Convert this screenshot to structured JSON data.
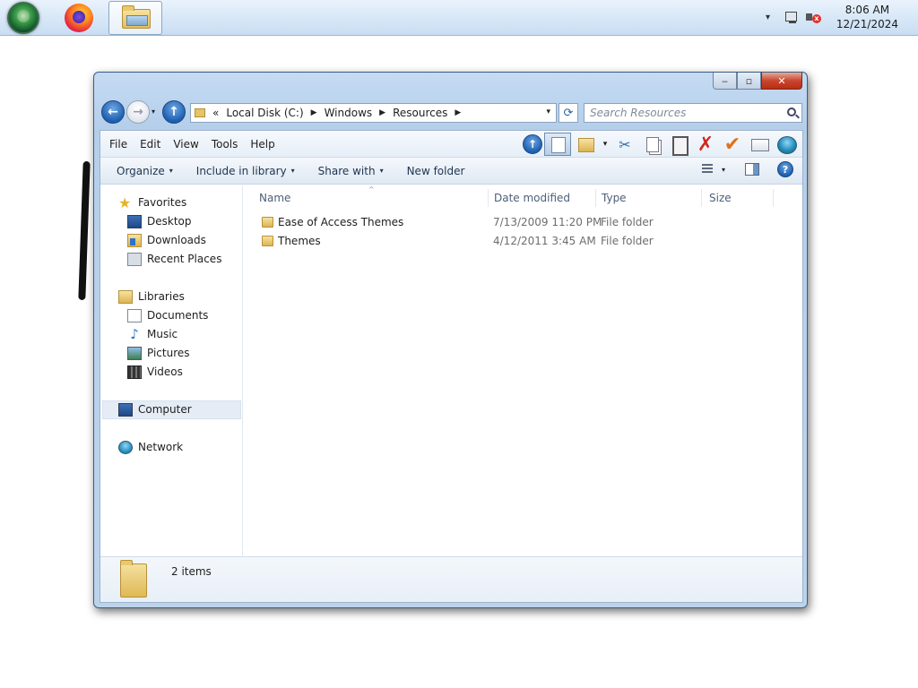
{
  "taskbar": {
    "clock_time": "8:06 AM",
    "clock_date": "12/21/2024",
    "tray_overflow": "▾",
    "volume_muted": "x"
  },
  "window": {
    "caption": {
      "minimize": "‒",
      "maximize": "▫",
      "close": "✕"
    },
    "nav": {
      "back": "←",
      "forward": "→",
      "up": "↑",
      "history_drop": "▾"
    },
    "address": {
      "overflow": "«",
      "segments": [
        "Local Disk (C:)",
        "Windows",
        "Resources"
      ],
      "separator": "▶",
      "dropdown": "▾"
    },
    "refresh": "⟳",
    "search": {
      "placeholder": "Search Resources"
    },
    "menu": [
      "File",
      "Edit",
      "View",
      "Tools",
      "Help"
    ],
    "toolbar": {
      "up": "↑",
      "drop": "▾",
      "scissors": "✂",
      "delete": "✗",
      "check": "✔"
    },
    "command_bar": {
      "organize": "Organize",
      "include_in_library": "Include in library",
      "share_with": "Share with",
      "new_folder": "New folder",
      "caret": "▾",
      "help": "?"
    },
    "navigation_pane": {
      "favorites": {
        "label": "Favorites",
        "items": [
          "Desktop",
          "Downloads",
          "Recent Places"
        ]
      },
      "libraries": {
        "label": "Libraries",
        "items": [
          "Documents",
          "Music",
          "Pictures",
          "Videos"
        ]
      },
      "computer": "Computer",
      "network": "Network",
      "star": "★",
      "note": "♪"
    },
    "file_list": {
      "columns": [
        "Name",
        "Date modified",
        "Type",
        "Size"
      ],
      "sort_indicator": "^",
      "rows": [
        {
          "name": "Ease of Access Themes",
          "date": "7/13/2009 11:20 PM",
          "type": "File folder"
        },
        {
          "name": "Themes",
          "date": "4/12/2011 3:45 AM",
          "type": "File folder"
        }
      ]
    },
    "details_pane": {
      "item_count": "2 items"
    }
  }
}
